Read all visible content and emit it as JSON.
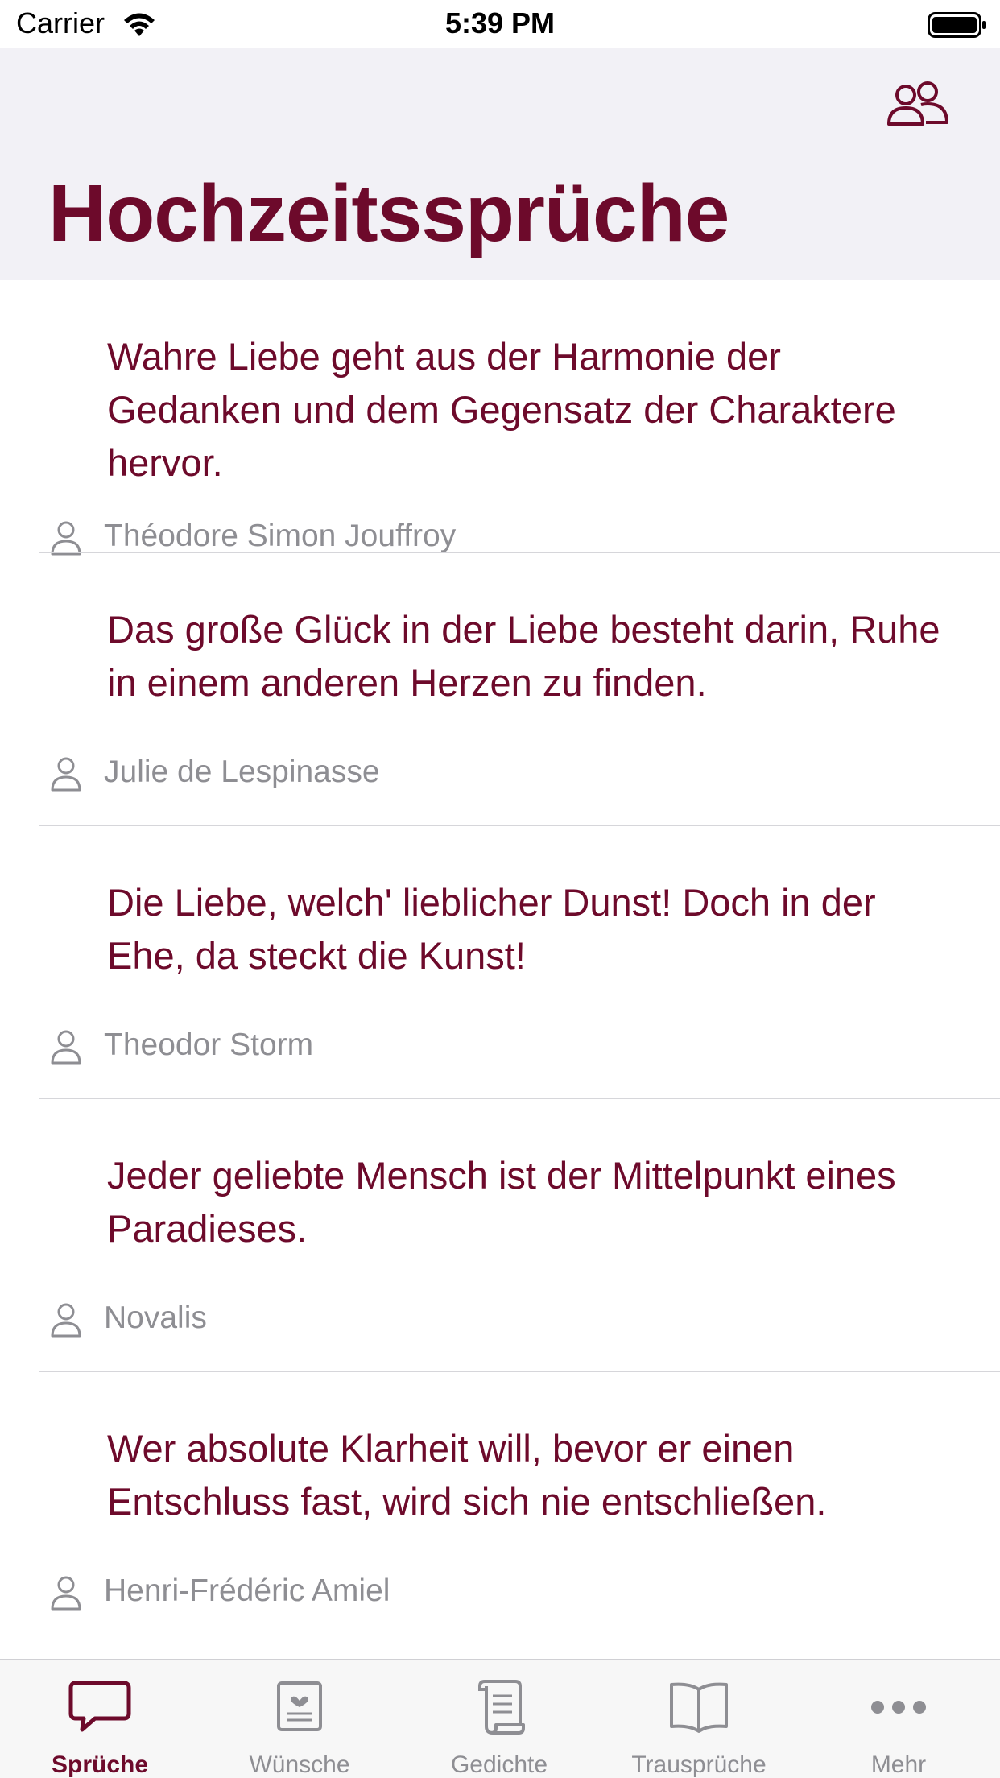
{
  "status_bar": {
    "carrier": "Carrier",
    "time": "5:39 PM"
  },
  "header": {
    "title": "Hochzeitssprüche",
    "people_icon": "people-icon"
  },
  "quotes": [
    {
      "text": "Wahre Liebe geht aus der Harmonie der Gedanken und dem Gegensatz der Charaktere hervor.",
      "author": "Théodore Simon Jouffroy"
    },
    {
      "text": "Das große Glück in der Liebe besteht darin, Ruhe in einem anderen Herzen zu finden.",
      "author": "Julie de Lespinasse"
    },
    {
      "text": "Die Liebe, welch' lieblicher Dunst! Doch in der Ehe, da steckt die Kunst!",
      "author": "Theodor Storm"
    },
    {
      "text": "Jeder geliebte Mensch ist der Mittelpunkt eines Paradieses.",
      "author": "Novalis"
    },
    {
      "text": "Wer absolute Klarheit will, bevor er einen Entschluss fast, wird sich nie entschließen.",
      "author": "Henri-Frédéric Amiel"
    }
  ],
  "tabs": [
    {
      "label": "Sprüche",
      "icon": "speech-bubble-icon",
      "active": true
    },
    {
      "label": "Wünsche",
      "icon": "card-icon",
      "active": false
    },
    {
      "label": "Gedichte",
      "icon": "scroll-icon",
      "active": false
    },
    {
      "label": "Trausprüche",
      "icon": "book-icon",
      "active": false
    },
    {
      "label": "Mehr",
      "icon": "more-icon",
      "active": false
    }
  ],
  "colors": {
    "accent": "#6d0a2b",
    "secondary_text": "#8e8e93",
    "header_bg": "#f2f1f6"
  }
}
